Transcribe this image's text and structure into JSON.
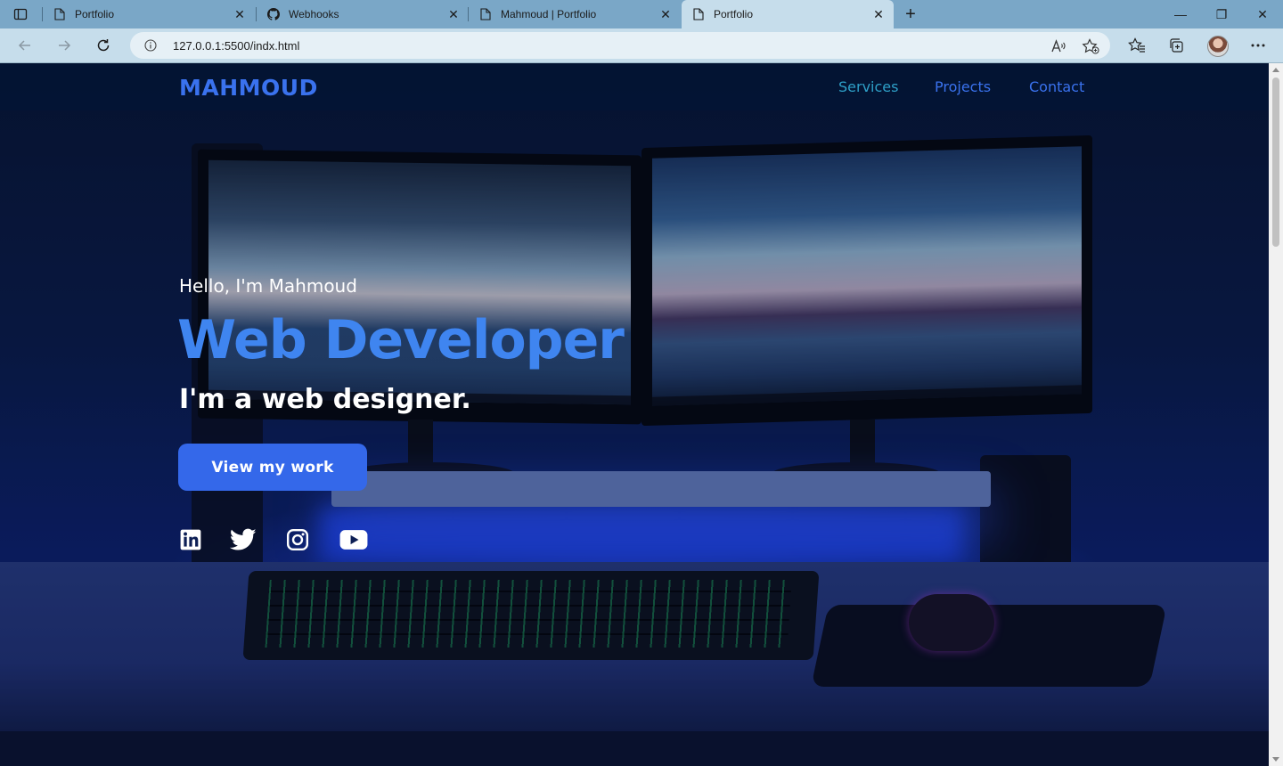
{
  "browser": {
    "tabs": [
      {
        "label": "Portfolio",
        "icon": "page-icon",
        "active": false
      },
      {
        "label": "Webhooks",
        "icon": "github-icon",
        "active": false
      },
      {
        "label": "Mahmoud | Portfolio",
        "icon": "page-icon",
        "active": false
      },
      {
        "label": "Portfolio",
        "icon": "page-icon",
        "active": true
      }
    ],
    "close_glyph": "✕",
    "new_tab_glyph": "+",
    "url": "127.0.0.1:5500/indx.html",
    "window_controls": {
      "minimize": "—",
      "restore": "❐",
      "close": "✕"
    }
  },
  "site": {
    "logo": "MAHMOUD",
    "nav": [
      {
        "label": "Services",
        "color": "#2ea0c8"
      },
      {
        "label": "Projects",
        "color": "#3a72ee"
      },
      {
        "label": "Contact",
        "color": "#3a72ee"
      }
    ],
    "hero": {
      "greeting": "Hello, I'm Mahmoud",
      "role": "Web Developer",
      "tagline": "I'm a web designer.",
      "cta_label": "View my work"
    },
    "social": [
      "linkedin-icon",
      "twitter-icon",
      "instagram-icon",
      "youtube-icon"
    ]
  },
  "colors": {
    "accent": "#3468ea",
    "header_bg": "#021434",
    "role_text": "#3f85f0"
  }
}
